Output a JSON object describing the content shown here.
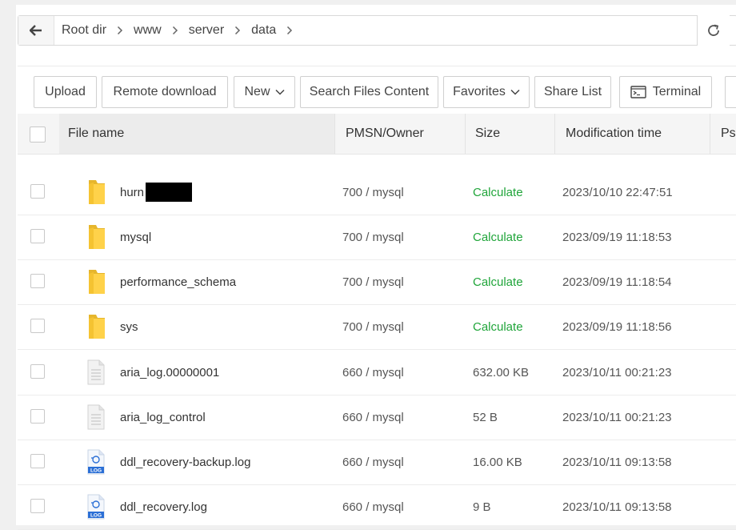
{
  "breadcrumb": {
    "items": [
      "Root dir",
      "www",
      "server",
      "data"
    ]
  },
  "toolbar": {
    "upload": "Upload",
    "remote_download": "Remote download",
    "new": "New",
    "search_files_content": "Search Files Content",
    "favorites": "Favorites",
    "share_list": "Share List",
    "terminal": "Terminal"
  },
  "table": {
    "headers": {
      "name": "File name",
      "perm": "PMSN/Owner",
      "size": "Size",
      "mtime": "Modification time",
      "ps": "Ps"
    },
    "rows": [
      {
        "icon": "folder-icon",
        "name": "hurn",
        "redacted": true,
        "perm": "700 / mysql",
        "size": "Calculate",
        "mtime": "2023/10/10 22:47:51"
      },
      {
        "icon": "folder-icon",
        "name": "mysql",
        "perm": "700 / mysql",
        "size": "Calculate",
        "mtime": "2023/09/19 11:18:53"
      },
      {
        "icon": "folder-icon",
        "name": "performance_schema",
        "perm": "700 / mysql",
        "size": "Calculate",
        "mtime": "2023/09/19 11:18:54"
      },
      {
        "icon": "folder-icon",
        "name": "sys",
        "perm": "700 / mysql",
        "size": "Calculate",
        "mtime": "2023/09/19 11:18:56"
      },
      {
        "icon": "file-icon",
        "name": "aria_log.00000001",
        "perm": "660 / mysql",
        "size": "632.00 KB",
        "mtime": "2023/10/11 00:21:23"
      },
      {
        "icon": "file-icon",
        "name": "aria_log_control",
        "perm": "660 / mysql",
        "size": "52 B",
        "mtime": "2023/10/11 00:21:23"
      },
      {
        "icon": "log-file-icon",
        "name": "ddl_recovery-backup.log",
        "perm": "660 / mysql",
        "size": "16.00 KB",
        "mtime": "2023/10/11 09:13:58"
      },
      {
        "icon": "log-file-icon",
        "name": "ddl_recovery.log",
        "perm": "660 / mysql",
        "size": "9 B",
        "mtime": "2023/10/11 09:13:58"
      }
    ]
  },
  "icons": {
    "log_badge": "LOG"
  },
  "colors": {
    "calculate": "#20a53a",
    "folder": "#ffd24a",
    "log_badge": "#2b6fd6"
  }
}
